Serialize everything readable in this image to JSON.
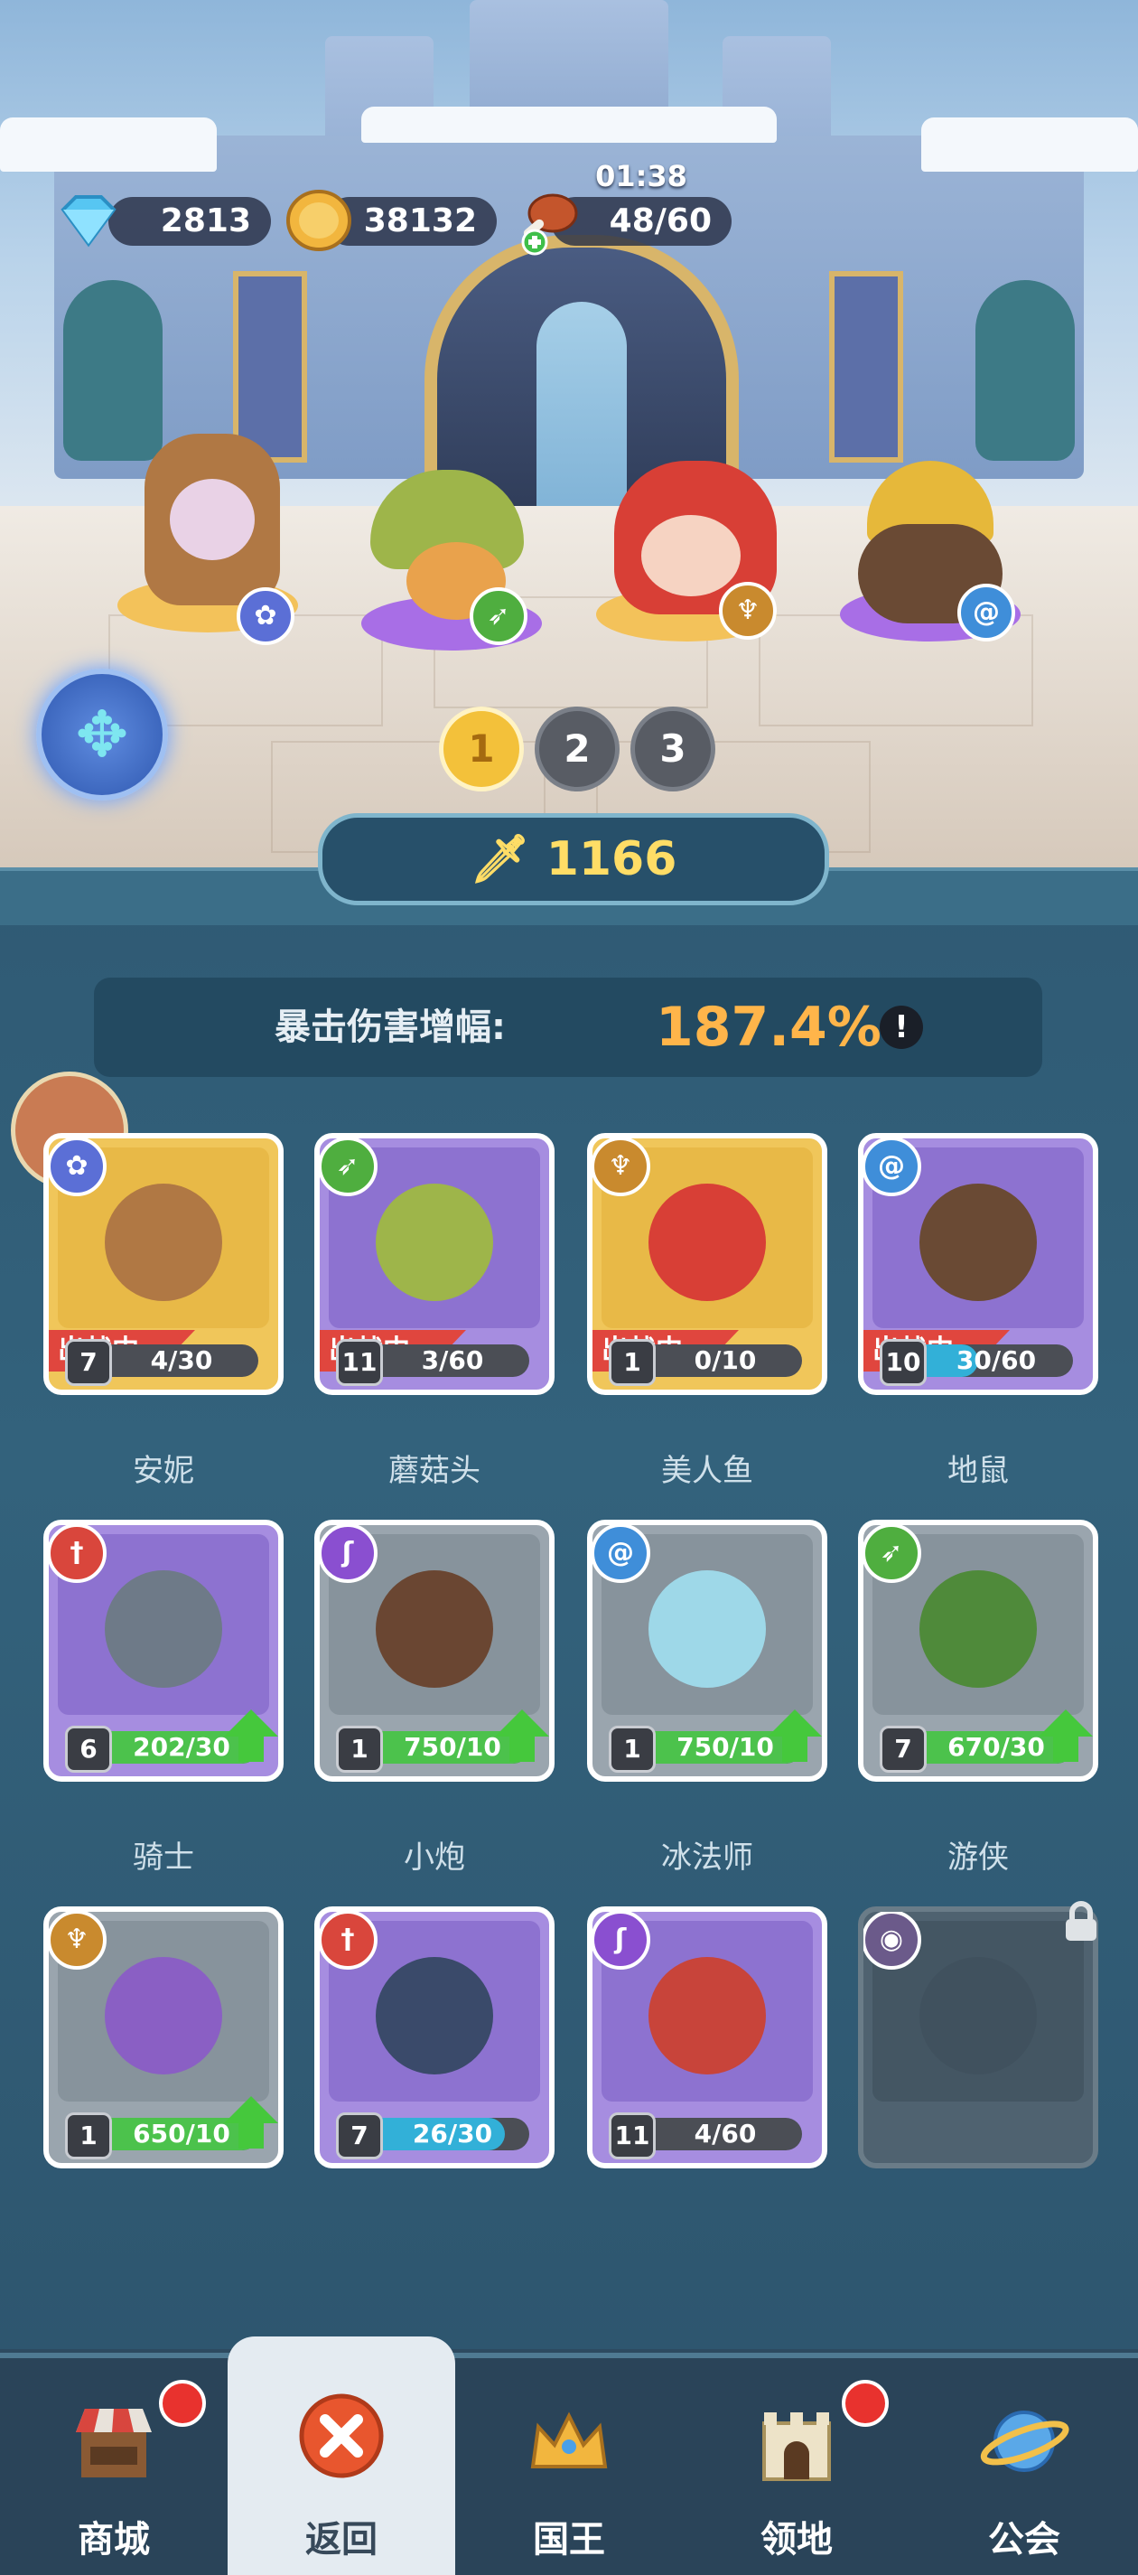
{
  "resources": {
    "gems": "2813",
    "coins": "38132",
    "stamina": "48/60",
    "stamina_timer": "01:38"
  },
  "team_pages": [
    "1",
    "2",
    "3"
  ],
  "active_page": "1",
  "power": "1166",
  "crit": {
    "label": "暴击伤害增幅:",
    "value": "187.4%",
    "info": "!"
  },
  "deployed_label": "出战中",
  "heroes": [
    {
      "name": "安妮",
      "level": "7",
      "progress": "4/30",
      "fill": 0.13,
      "deployed": true,
      "rarity": "gold",
      "class_icon": "paw-icon",
      "class_color": "#5b6fd6"
    },
    {
      "name": "蘑菇头",
      "level": "11",
      "progress": "3/60",
      "fill": 0.05,
      "deployed": true,
      "rarity": "purple",
      "class_icon": "bow-icon",
      "class_color": "#4fae3f"
    },
    {
      "name": "美人鱼",
      "level": "1",
      "progress": "0/10",
      "fill": 0.0,
      "deployed": true,
      "rarity": "gold",
      "class_icon": "wings-icon",
      "class_color": "#c98a2e"
    },
    {
      "name": "地鼠",
      "level": "10",
      "progress": "30/60",
      "fill": 0.5,
      "deployed": true,
      "rarity": "purple",
      "class_icon": "spiral-icon",
      "class_color": "#3f8ed9"
    },
    {
      "name": "骑士",
      "level": "6",
      "progress": "202/30",
      "fill": 1.0,
      "upgradable": true,
      "rarity": "purple",
      "class_icon": "sword-icon",
      "class_color": "#d9463c"
    },
    {
      "name": "小炮",
      "level": "1",
      "progress": "750/10",
      "fill": 1.0,
      "upgradable": true,
      "rarity": "gray",
      "class_icon": "staff-icon",
      "class_color": "#8a4fd0"
    },
    {
      "name": "冰法师",
      "level": "1",
      "progress": "750/10",
      "fill": 1.0,
      "upgradable": true,
      "rarity": "gray",
      "class_icon": "spiral-icon",
      "class_color": "#3f8ed9"
    },
    {
      "name": "游侠",
      "level": "7",
      "progress": "670/30",
      "fill": 1.0,
      "upgradable": true,
      "rarity": "gray",
      "class_icon": "bow-icon",
      "class_color": "#4fae3f"
    },
    {
      "name": "",
      "level": "1",
      "progress": "650/10",
      "fill": 1.0,
      "upgradable": true,
      "rarity": "gray",
      "class_icon": "wings-icon",
      "class_color": "#c98a2e"
    },
    {
      "name": "",
      "level": "7",
      "progress": "26/30",
      "fill": 0.87,
      "rarity": "purple",
      "class_icon": "sword-icon",
      "class_color": "#d9463c"
    },
    {
      "name": "",
      "level": "11",
      "progress": "4/60",
      "fill": 0.07,
      "rarity": "purple",
      "class_icon": "staff-icon",
      "class_color": "#8a4fd0"
    },
    {
      "name": "",
      "locked": true,
      "rarity": "locked",
      "class_icon": "eye-icon",
      "class_color": "#6b5a8a"
    }
  ],
  "nav": [
    {
      "label": "商城",
      "icon": "shop-icon",
      "dot": true
    },
    {
      "label": "返回",
      "icon": "close-icon",
      "active": true
    },
    {
      "label": "国王",
      "icon": "crown-icon"
    },
    {
      "label": "领地",
      "icon": "castle-icon",
      "dot": true
    },
    {
      "label": "公会",
      "icon": "planet-icon"
    }
  ]
}
